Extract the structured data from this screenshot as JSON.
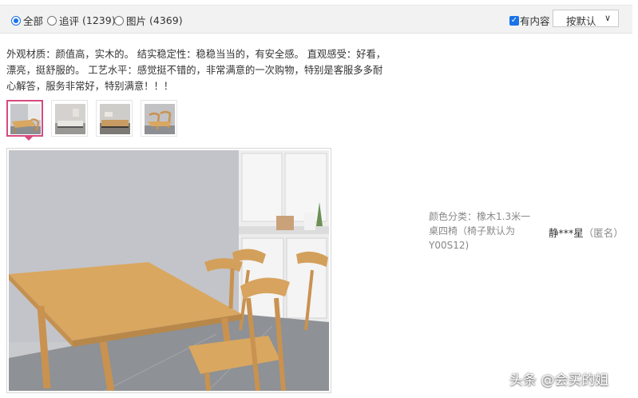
{
  "filters": {
    "all_label": "全部",
    "followup_label": "追评",
    "followup_count": "(1239)",
    "pictures_label": "图片",
    "pictures_count": "(4369)",
    "has_content_label": "有内容",
    "sort_label": "按默认",
    "selected": "all"
  },
  "review": {
    "text": "外观材质：颜值高，实木的。 结实稳定性：稳稳当当的，有安全感。 直观感受：好看，漂亮，挺舒服的。 工艺水平：感觉挺不错的，非常满意的一次购物，特别是客服多多耐心解答，服务非常好，特别满意！！！",
    "thumbnail_count": 4,
    "selected_thumbnail": 1
  },
  "sku": {
    "label": "颜色分类：",
    "value": "橡木1.3米一桌四椅（椅子默认为Y00S12)"
  },
  "user": {
    "name": "静***星",
    "anonymous": "（匿名）"
  },
  "watermark": "头条 @会买的姐",
  "colors": {
    "accent": "#1a73e8",
    "thumb_selected": "#d64a80",
    "wood": "#d9a760"
  }
}
